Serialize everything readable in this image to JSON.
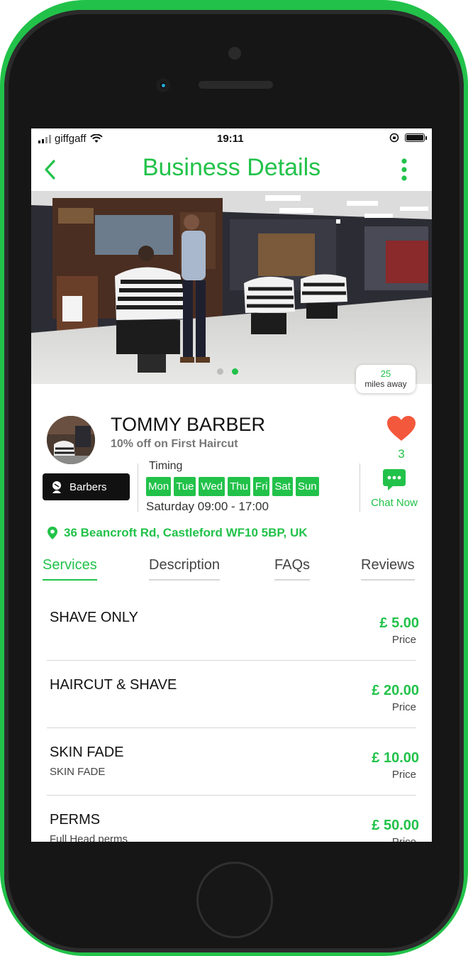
{
  "status_bar": {
    "carrier": "giffgaff",
    "time": "19:11"
  },
  "header": {
    "title": "Business Details"
  },
  "hero": {
    "distance_value": "25",
    "distance_label": "miles away",
    "slide_count": 2,
    "active_slide": 2
  },
  "business": {
    "name": "TOMMY BARBER",
    "offer": "10% off on First Haircut",
    "likes": "3",
    "category": "Barbers",
    "timing_label": "Timing",
    "days": [
      "Mon",
      "Tue",
      "Wed",
      "Thu",
      "Fri",
      "Sat",
      "Sun"
    ],
    "hours": "Saturday 09:00 - 17:00",
    "chat_label": "Chat Now",
    "address": "36 Beancroft Rd, Castleford WF10 5BP, UK"
  },
  "tabs": [
    {
      "label": "Services",
      "active": true
    },
    {
      "label": "Description",
      "active": false
    },
    {
      "label": "FAQs",
      "active": false
    },
    {
      "label": "Reviews",
      "active": false
    }
  ],
  "services": [
    {
      "name": "SHAVE ONLY",
      "description": "",
      "price": "£ 5.00",
      "price_label": "Price"
    },
    {
      "name": "HAIRCUT & SHAVE",
      "description": "",
      "price": "£ 20.00",
      "price_label": "Price"
    },
    {
      "name": "SKIN FADE",
      "description": "SKIN FADE",
      "price": "£ 10.00",
      "price_label": "Price"
    },
    {
      "name": "PERMS",
      "description": "Full Head perms",
      "price": "£ 50.00",
      "price_label": "Price"
    }
  ],
  "colors": {
    "accent": "#22c24a",
    "heart": "#f4583c",
    "frame": "#161616"
  }
}
